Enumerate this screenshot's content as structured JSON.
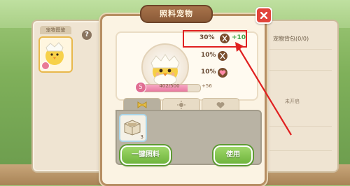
{
  "dialog": {
    "title": "照料宠物",
    "close_icon": "close-icon"
  },
  "left_panel": {
    "tab_label": "宠物图鉴",
    "help_label": "?"
  },
  "right_panel": {
    "title": "宠物背包(0/0)",
    "note": "未开启"
  },
  "pet": {
    "level": "5",
    "exp_text": "402/500",
    "exp_bonus": "+56",
    "exp_fraction": 0.8
  },
  "stats": [
    {
      "percent": "30%",
      "icon": "food-icon",
      "bonus": "+10"
    },
    {
      "percent": "10%",
      "icon": "food-icon",
      "bonus": ""
    },
    {
      "percent": "10%",
      "icon": "heart-icon",
      "bonus": ""
    }
  ],
  "tabs": [
    {
      "icon": "bow-icon",
      "active": true
    },
    {
      "icon": "sun-icon",
      "active": false
    },
    {
      "icon": "heart-icon",
      "active": false
    }
  ],
  "item": {
    "count": "3"
  },
  "buttons": {
    "one_click_feed": "一键照料",
    "use": "使用"
  },
  "colors": {
    "highlight": "#e02020",
    "accent_green": "#6fb43d",
    "title_brown": "#8a5a37"
  }
}
